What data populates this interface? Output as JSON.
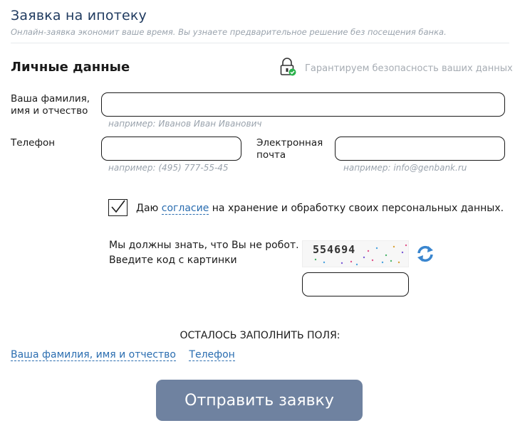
{
  "header": {
    "title": "Заявка на ипотеку",
    "subtitle": "Онлайн-заявка экономит ваше время. Вы узнаете предварительное решение без посещения банка."
  },
  "section": {
    "title": "Личные данные",
    "security_note": "Гарантируем безопасность ваших данных",
    "security_icon": "lock-check-icon"
  },
  "fields": {
    "fio": {
      "label": "Ваша фамилия,\nимя и отчество",
      "value": "",
      "hint": "например: Иванов Иван Иванович"
    },
    "phone": {
      "label": "Телефон",
      "value": "",
      "hint": "например: (495) 777-55-45"
    },
    "email": {
      "label": "Электронная\nпочта",
      "value": "",
      "hint": "например: info@genbank.ru"
    }
  },
  "consent": {
    "checked": true,
    "prefix": "Даю",
    "link": "согласие",
    "suffix": "на хранение и обработку своих персональных данных."
  },
  "captcha": {
    "line1": "Мы должны знать, что Вы не робот.",
    "line2": "Введите код с картинки",
    "code": "554694",
    "refresh_icon": "refresh-icon",
    "value": ""
  },
  "remaining": {
    "title": "ОСТАЛОСЬ ЗАПОЛНИТЬ ПОЛЯ:",
    "items": [
      "Ваша фамилия, имя и отчество",
      "Телефон"
    ]
  },
  "submit_label": "Отправить заявку",
  "colors": {
    "title": "#1f3a5f",
    "link": "#2a6db0",
    "submit_bg": "#6f82a0",
    "check_green": "#2bb24c"
  }
}
